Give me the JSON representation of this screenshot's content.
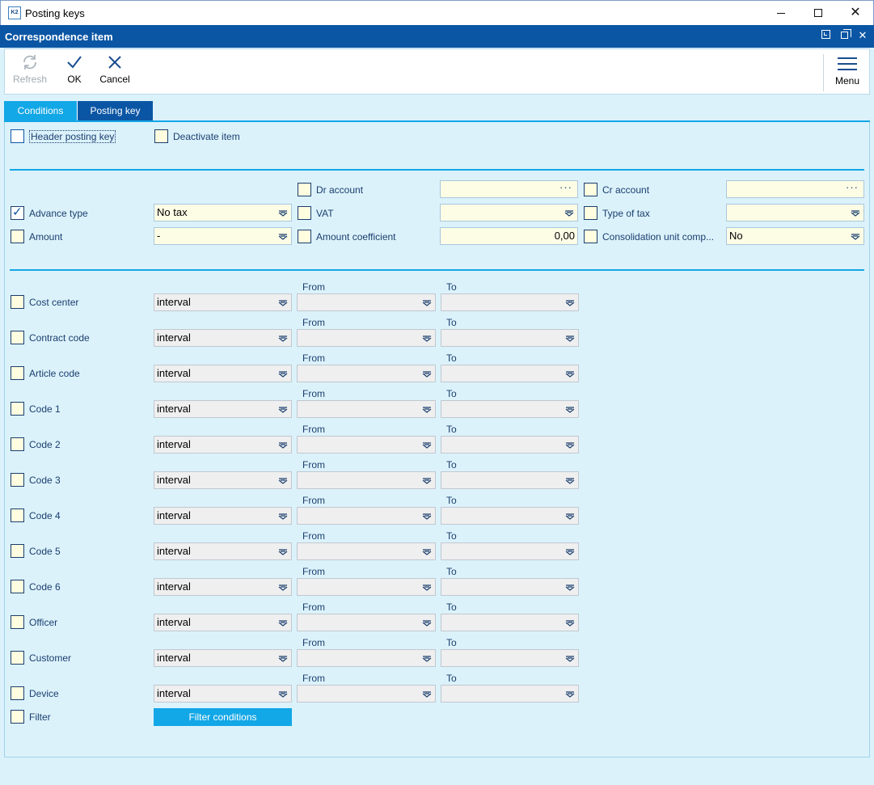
{
  "os_window": {
    "title": "Posting keys",
    "icon_text": "K2"
  },
  "inner_window": {
    "title": "Correspondence item"
  },
  "toolbar": {
    "refresh_label": "Refresh",
    "ok_label": "OK",
    "cancel_label": "Cancel",
    "menu_label": "Menu"
  },
  "tabs": [
    {
      "label": "Conditions",
      "active": true
    },
    {
      "label": "Posting key",
      "active": false
    }
  ],
  "header_section": {
    "header_posting_key": {
      "label": "Header posting key",
      "checked": false
    },
    "deactivate_item": {
      "label": "Deactivate item",
      "checked": false
    }
  },
  "account_section": {
    "advance_type": {
      "label": "Advance type",
      "checked": true,
      "value": "No tax"
    },
    "amount": {
      "label": "Amount",
      "checked": false,
      "value": "-"
    },
    "dr_account": {
      "label": "Dr account",
      "checked": false,
      "value": ""
    },
    "vat": {
      "label": "VAT",
      "checked": false,
      "value": ""
    },
    "amount_coefficient": {
      "label": "Amount coefficient",
      "checked": false,
      "value": "0,00"
    },
    "cr_account": {
      "label": "Cr account",
      "checked": false,
      "value": ""
    },
    "type_of_tax": {
      "label": "Type of tax",
      "checked": false,
      "value": ""
    },
    "consolidation_unit": {
      "label": "Consolidation unit comp...",
      "checked": false,
      "value": "No"
    }
  },
  "interval_section": {
    "from_label": "From",
    "to_label": "To",
    "rows": [
      {
        "label": "Cost center",
        "mode": "interval"
      },
      {
        "label": "Contract code",
        "mode": "interval"
      },
      {
        "label": "Article code",
        "mode": "interval"
      },
      {
        "label": "Code 1",
        "mode": "interval"
      },
      {
        "label": "Code 2",
        "mode": "interval"
      },
      {
        "label": "Code 3",
        "mode": "interval"
      },
      {
        "label": "Code 4",
        "mode": "interval"
      },
      {
        "label": "Code 5",
        "mode": "interval"
      },
      {
        "label": "Code 6",
        "mode": "interval"
      },
      {
        "label": "Officer",
        "mode": "interval"
      },
      {
        "label": "Customer",
        "mode": "interval"
      },
      {
        "label": "Device",
        "mode": "interval"
      }
    ]
  },
  "filter": {
    "label": "Filter",
    "checked": false,
    "button_label": "Filter conditions"
  },
  "colors": {
    "accent": "#12a7e6",
    "titlebar": "#0b56a4",
    "background": "#dcf2fb",
    "field_yellow": "#fdfde6"
  }
}
